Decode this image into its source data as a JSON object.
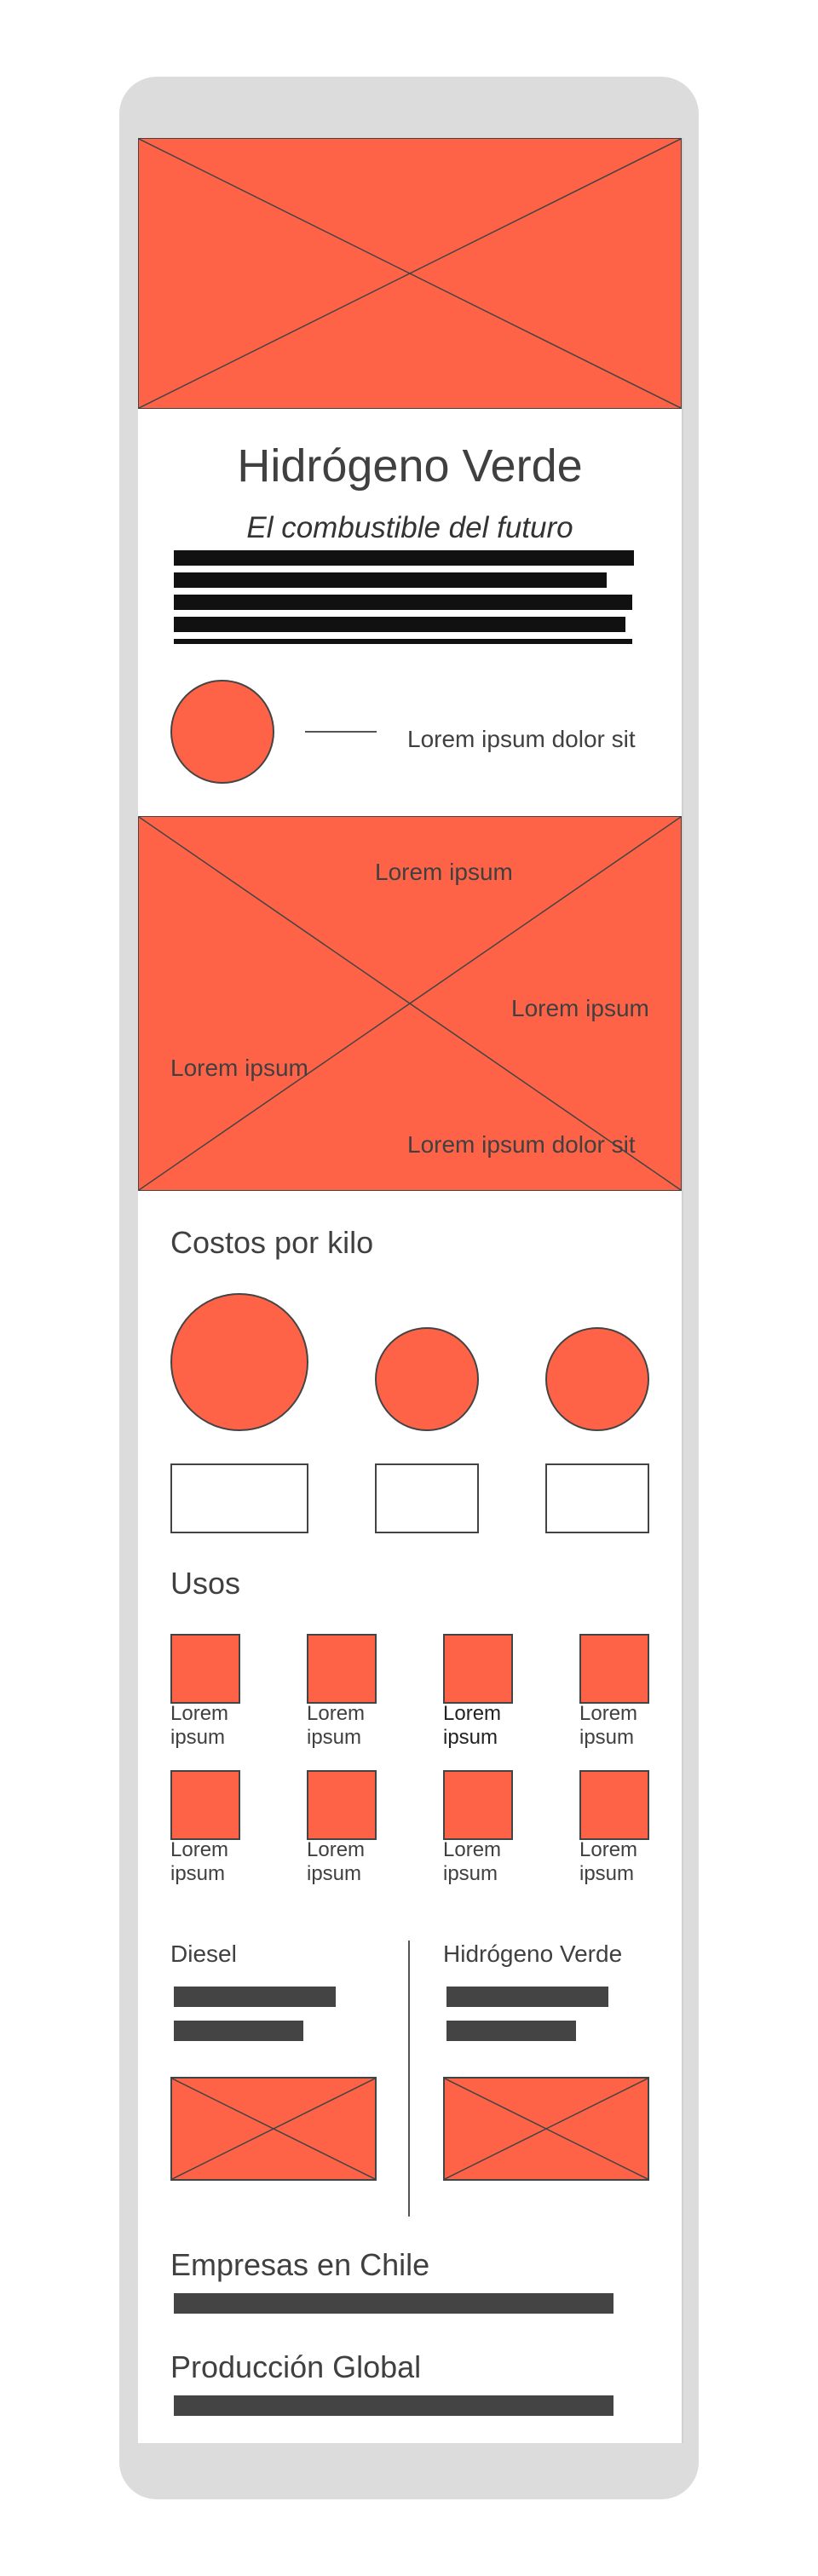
{
  "hero": {
    "title": "Hidrógeno Verde",
    "subtitle": "El combustible del futuro"
  },
  "intro": {
    "caption": "Lorem ipsum dolor sit"
  },
  "map": {
    "labels": [
      "Lorem ipsum",
      "Lorem ipsum",
      "Lorem ipsum",
      "Lorem ipsum dolor sit"
    ]
  },
  "costs": {
    "heading": "Costos por kilo"
  },
  "uses": {
    "heading": "Usos",
    "items": [
      {
        "line1": "Lorem",
        "line2": "ipsum"
      },
      {
        "line1": "Lorem",
        "line2": "ipsum"
      },
      {
        "line1": "Lorem",
        "line2": "ipsum"
      },
      {
        "line1": "Lorem",
        "line2": "ipsum"
      },
      {
        "line1": "Lorem",
        "line2": "ipsum"
      },
      {
        "line1": "Lorem",
        "line2": "ipsum"
      },
      {
        "line1": "Lorem",
        "line2": "ipsum"
      },
      {
        "line1": "Lorem",
        "line2": "ipsum"
      }
    ]
  },
  "comparison": {
    "left_title": "Diesel",
    "right_title": "Hidrógeno Verde"
  },
  "companies": {
    "heading": "Empresas en Chile"
  },
  "production": {
    "heading": "Producción Global"
  },
  "colors": {
    "accent": "#ff6347",
    "frame": "#dcdcdc",
    "ink": "#404040"
  }
}
